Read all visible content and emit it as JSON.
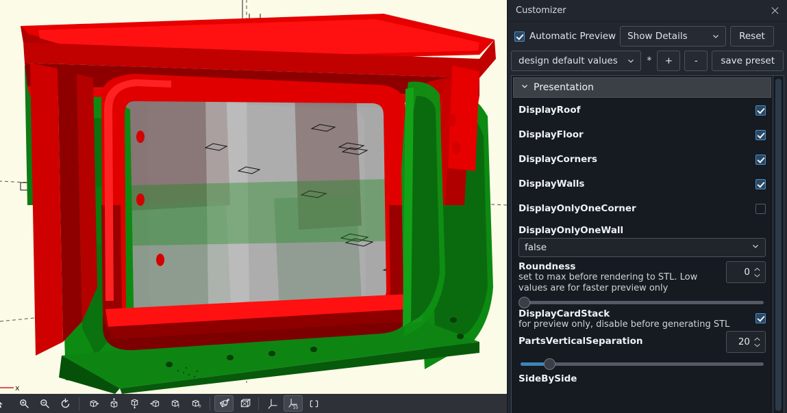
{
  "panel": {
    "title": "Customizer",
    "close_icon": "close-icon",
    "automatic_preview": {
      "label": "Automatic Preview",
      "checked": true
    },
    "details_select": {
      "value": "Show Details",
      "chevron_icon": "chevron-down-icon"
    },
    "reset_button": "Reset",
    "preset_select": {
      "value": "design default values",
      "chevron_icon": "chevron-down-icon"
    },
    "modified_marker": "*",
    "add_preset_button": "+",
    "remove_preset_button": "-",
    "save_preset_button": "save preset",
    "group": {
      "title": "Presentation",
      "collapse_icon": "chevron-down-icon",
      "expanded": true
    },
    "parameters": [
      {
        "kind": "checkbox",
        "name": "DisplayRoof",
        "checked": true
      },
      {
        "kind": "checkbox",
        "name": "DisplayFloor",
        "checked": true
      },
      {
        "kind": "checkbox",
        "name": "DisplayCorners",
        "checked": true
      },
      {
        "kind": "checkbox",
        "name": "DisplayWalls",
        "checked": true
      },
      {
        "kind": "checkbox",
        "name": "DisplayOnlyOneCorner",
        "checked": false
      },
      {
        "kind": "dropdown",
        "name": "DisplayOnlyOneWall",
        "value": "false"
      },
      {
        "kind": "slider",
        "name": "Roundness",
        "description": "set to max before rendering to STL. Low values are for faster preview only",
        "value": "0",
        "fill_percent": 0
      },
      {
        "kind": "checkbox",
        "name": "DisplayCardStack",
        "description": "for preview only, disable before generating STL",
        "checked": true
      },
      {
        "kind": "slider",
        "name": "PartsVerticalSeparation",
        "value": "20",
        "fill_percent": 13
      },
      {
        "kind": "label",
        "name": "SideBySide"
      }
    ],
    "scrollbar": "vertical-scrollbar"
  },
  "viewport": {
    "background_color": "#fcfbe8",
    "axis_label_x": "x",
    "model_colors": {
      "red": "#e00000",
      "red_dark": "#8b0000",
      "green": "#0a8a0a",
      "green_dark": "#055205",
      "grey": "#9a9a9a"
    }
  },
  "toolbar": {
    "buttons": [
      {
        "icon": "select-cursor-icon",
        "active": false
      },
      {
        "icon": "zoom-in-icon",
        "active": false
      },
      {
        "icon": "zoom-out-icon",
        "active": false
      },
      {
        "icon": "reset-view-icon",
        "active": false
      },
      {
        "icon": "view-right-icon",
        "active": false
      },
      {
        "icon": "view-top-icon",
        "active": false
      },
      {
        "icon": "view-bottom-icon",
        "active": false
      },
      {
        "icon": "view-left-icon",
        "active": false
      },
      {
        "icon": "view-front-icon",
        "active": false
      },
      {
        "icon": "view-back-icon",
        "active": false
      },
      {
        "icon": "perspective-view-icon",
        "active": true
      },
      {
        "icon": "orthogonal-view-icon",
        "active": false
      },
      {
        "icon": "show-axes-icon",
        "active": false
      },
      {
        "icon": "show-scale-markers-icon",
        "active": true
      },
      {
        "icon": "show-crosshairs-icon",
        "active": false
      }
    ]
  }
}
